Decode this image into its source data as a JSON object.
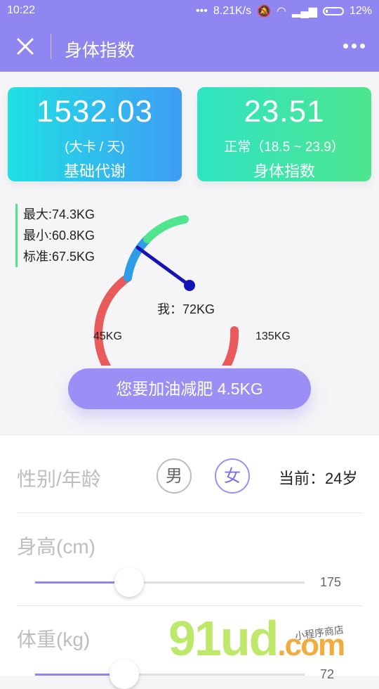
{
  "status_bar": {
    "time": "10:22",
    "network_speed": "8.21K/s",
    "battery": "12%"
  },
  "header": {
    "title": "身体指数"
  },
  "metrics": {
    "bmr": {
      "value": "1532.03",
      "unit": "(大卡 / 天)",
      "label": "基础代谢"
    },
    "bmi": {
      "value": "23.51",
      "status": "正常（18.5 ~ 23.9）",
      "label": "身体指数"
    }
  },
  "weight_stats": {
    "max": "最大:74.3KG",
    "min": "最小:60.8KG",
    "standard": "标准:67.5KG"
  },
  "gauge": {
    "min_label": "45KG",
    "max_label": "135KG",
    "me_label": "我：72KG",
    "min": 45,
    "max": 135,
    "current": 72,
    "colors": {
      "red": "#e95a5a",
      "blue": "#2e9de6",
      "green": "#4ee58e",
      "needle": "#1313b8"
    }
  },
  "cta": {
    "label": "您要加油减肥 4.5KG"
  },
  "form": {
    "gender_age_label": "性别/年龄",
    "male": "男",
    "female": "女",
    "current_age": "当前：24岁",
    "height_label": "身高(cm)",
    "height_value": "175",
    "height_fraction": 0.35,
    "weight_label": "体重(kg)",
    "weight_value": "72",
    "weight_fraction": 0.33
  },
  "watermark": {
    "brand": "91ud",
    "suffix": ".com",
    "tagline": "小程序商店"
  }
}
